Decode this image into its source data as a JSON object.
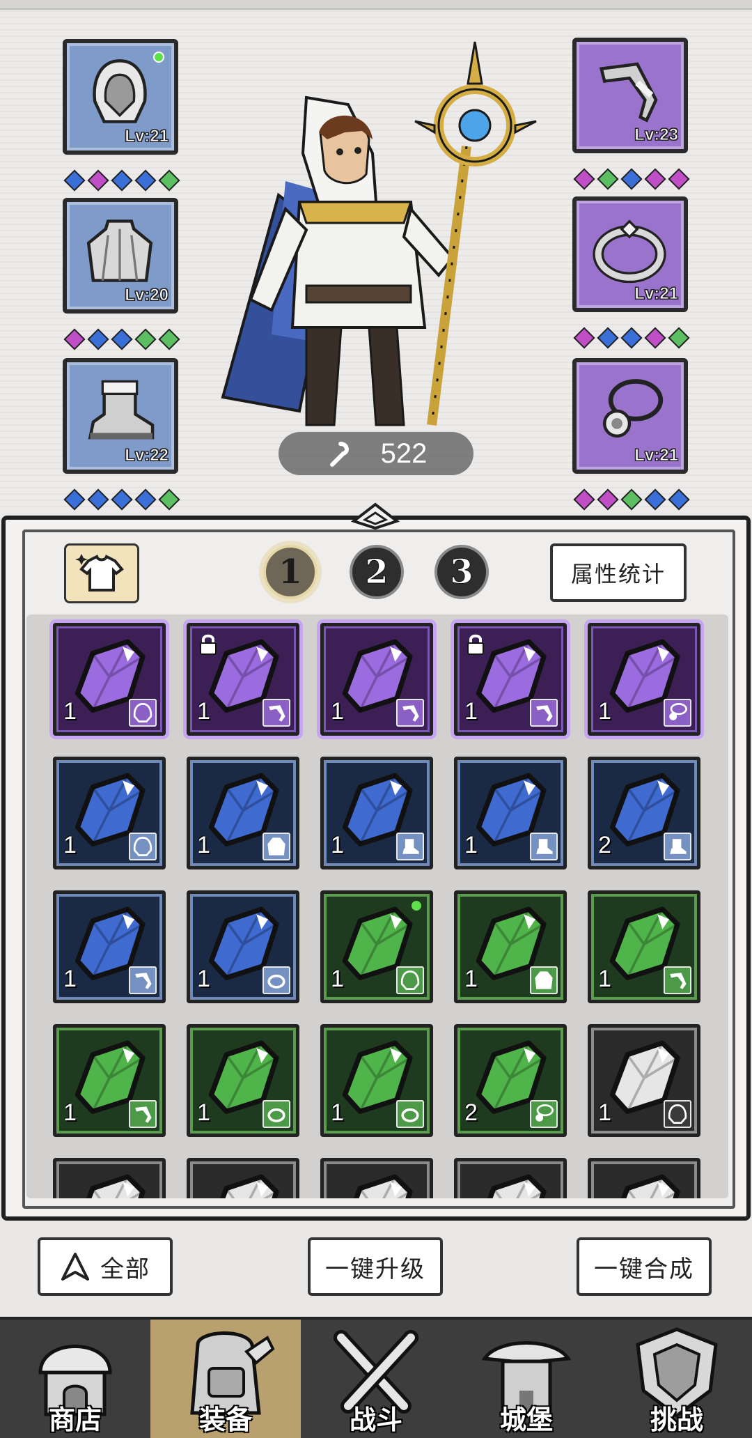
{
  "equipment_left": [
    {
      "slot": "hood",
      "level": "Lv:21",
      "rarity": "blue",
      "has_new": true,
      "gems": [
        "#3b6fd8",
        "#c04fc7",
        "#3b6fd8",
        "#3b6fd8",
        "#5cc062"
      ]
    },
    {
      "slot": "cape",
      "level": "Lv:20",
      "rarity": "blue",
      "has_new": false,
      "gems": [
        "#c04fc7",
        "#3b6fd8",
        "#3b6fd8",
        "#5cc062",
        "#5cc062"
      ]
    },
    {
      "slot": "boots",
      "level": "Lv:22",
      "rarity": "blue",
      "has_new": false,
      "gems": [
        "#3b6fd8",
        "#3b6fd8",
        "#3b6fd8",
        "#3b6fd8",
        "#5cc062"
      ]
    }
  ],
  "equipment_right": [
    {
      "slot": "weapon",
      "level": "Lv:23",
      "rarity": "purple",
      "gems": [
        "#c04fc7",
        "#5cc062",
        "#3b6fd8",
        "#c04fc7",
        "#c04fc7"
      ]
    },
    {
      "slot": "ring",
      "level": "Lv:21",
      "rarity": "purple",
      "gems": [
        "#c04fc7",
        "#3b6fd8",
        "#3b6fd8",
        "#c04fc7",
        "#5cc062"
      ]
    },
    {
      "slot": "amulet",
      "level": "Lv:21",
      "rarity": "purple",
      "gems": [
        "#c04fc7",
        "#c04fc7",
        "#5cc062",
        "#3b6fd8",
        "#3b6fd8"
      ]
    }
  ],
  "hero": {
    "power_value": "522"
  },
  "page_tabs": [
    {
      "label": "1",
      "active": true
    },
    {
      "label": "2",
      "active": false
    },
    {
      "label": "3",
      "active": false
    }
  ],
  "stats_button": "属性统计",
  "inventory": [
    [
      {
        "rarity": "purple",
        "count": "1",
        "type": "hood",
        "locked": false
      },
      {
        "rarity": "purple",
        "count": "1",
        "type": "weapon",
        "locked": true
      },
      {
        "rarity": "purple",
        "count": "1",
        "type": "weapon",
        "locked": false
      },
      {
        "rarity": "purple",
        "count": "1",
        "type": "weapon",
        "locked": true
      },
      {
        "rarity": "purple",
        "count": "1",
        "type": "amulet",
        "locked": false
      }
    ],
    [
      {
        "rarity": "blue",
        "count": "1",
        "type": "hood"
      },
      {
        "rarity": "blue",
        "count": "1",
        "type": "cape"
      },
      {
        "rarity": "blue",
        "count": "1",
        "type": "boots"
      },
      {
        "rarity": "blue",
        "count": "1",
        "type": "boots"
      },
      {
        "rarity": "blue",
        "count": "2",
        "type": "boots"
      }
    ],
    [
      {
        "rarity": "blue",
        "count": "1",
        "type": "weapon"
      },
      {
        "rarity": "blue",
        "count": "1",
        "type": "ring"
      },
      {
        "rarity": "green",
        "count": "1",
        "type": "hood",
        "new": true
      },
      {
        "rarity": "green",
        "count": "1",
        "type": "cape"
      },
      {
        "rarity": "green",
        "count": "1",
        "type": "weapon"
      }
    ],
    [
      {
        "rarity": "green",
        "count": "1",
        "type": "weapon"
      },
      {
        "rarity": "green",
        "count": "1",
        "type": "ring"
      },
      {
        "rarity": "green",
        "count": "1",
        "type": "ring"
      },
      {
        "rarity": "green",
        "count": "2",
        "type": "amulet"
      },
      {
        "rarity": "black",
        "count": "1",
        "type": "hood"
      }
    ],
    [
      {
        "rarity": "black",
        "count": "",
        "type": ""
      },
      {
        "rarity": "black",
        "count": "",
        "type": ""
      },
      {
        "rarity": "black",
        "count": "",
        "type": ""
      },
      {
        "rarity": "black",
        "count": "",
        "type": ""
      },
      {
        "rarity": "black",
        "count": "",
        "type": ""
      }
    ]
  ],
  "actions": {
    "filter_label": "全部",
    "upgrade_label": "一键升级",
    "merge_label": "一键合成"
  },
  "tabs": [
    {
      "label": "商店",
      "icon": "shop-icon",
      "active": false
    },
    {
      "label": "装备",
      "icon": "backpack-icon",
      "active": true
    },
    {
      "label": "战斗",
      "icon": "crossed-swords-icon",
      "active": false
    },
    {
      "label": "城堡",
      "icon": "castle-icon",
      "active": false
    },
    {
      "label": "挑战",
      "icon": "shield-icon",
      "active": false
    }
  ],
  "colors": {
    "purple_gem": "#9b6be0",
    "blue_gem": "#3f6ad0",
    "green_gem": "#4fb44a",
    "white_gem": "#e6e6e6"
  }
}
